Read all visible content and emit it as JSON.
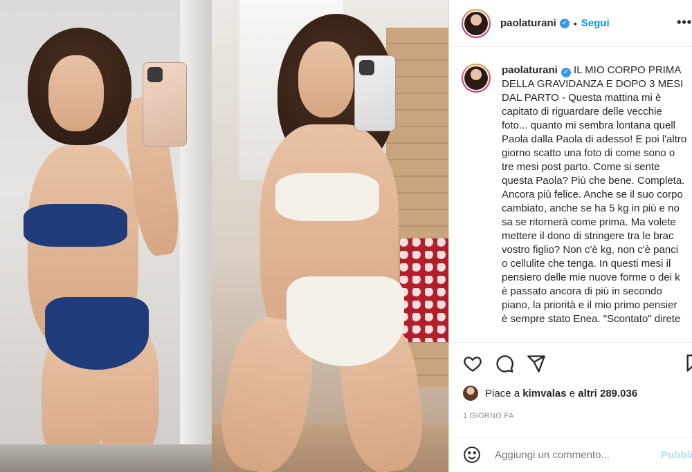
{
  "post": {
    "username": "paolaturani",
    "verified_mark": "✓",
    "separator": "•",
    "follow_label": "Segui",
    "more_label": "•••",
    "caption_lines": [
      "IL MIO CORPO PRIMA",
      "DELLA GRAVIDANZA E DOPO 3 MESI",
      "DAL PARTO - Questa mattina mi è",
      "capitato di riguardare delle vecchie",
      "foto... quanto mi sembra lontana quell",
      "Paola dalla Paola di adesso! E poi l'altro",
      "giorno scatto una foto di come sono o",
      "tre mesi post parto. Come si sente",
      "questa Paola? Più che bene. Completa.",
      "Ancora più felice. Anche se il suo corpo",
      "cambiato, anche se ha 5 kg in più e no",
      "sa se ritornerà come prima. Ma volete",
      "mettere il dono di stringere tra le brac",
      "vostro figlio? Non c'è kg, non c'è panci",
      "o cellulite che tenga. In questi mesi il",
      "pensiero delle mie nuove forme o dei k",
      "è passato ancora di più in secondo",
      "piano, la priorità e il mio primo pensier",
      "è sempre stato Enea. \"Scontato\" direte"
    ],
    "likes": {
      "prefix": "Piace a",
      "user": "kimvalas",
      "middle": "e",
      "count_text": "altri 289.036"
    },
    "time_ago": "1 GIORNO FA",
    "comment_placeholder": "Aggiungi un commento...",
    "publish_label": "Pubblica"
  },
  "icons": {
    "like": "heart-icon",
    "comment": "comment-icon",
    "share": "send-icon",
    "save": "bookmark-icon",
    "emoji": "emoji-icon",
    "verified": "verified-badge-icon"
  },
  "colors": {
    "follow": "#0095f6",
    "verified": "#3897f0",
    "muted": "#8e8e8e",
    "publish_disabled": "#b2dffc"
  }
}
